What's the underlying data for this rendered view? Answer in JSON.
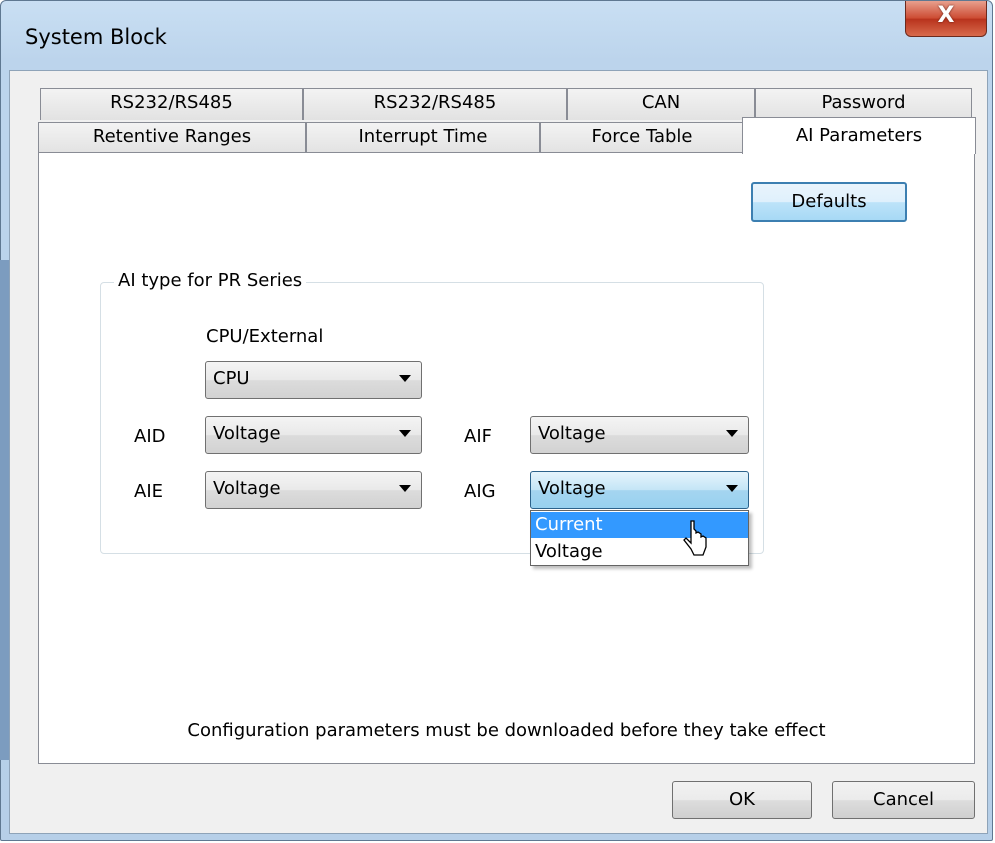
{
  "window": {
    "title": "System Block",
    "close_label": "X"
  },
  "tabs": {
    "row1": [
      "RS232/RS485",
      "RS232/RS485",
      "CAN",
      "Password"
    ],
    "row2": [
      "Retentive Ranges",
      "Interrupt Time",
      "Force Table",
      "AI Parameters"
    ],
    "active": "AI Parameters"
  },
  "panel": {
    "defaults_button": "Defaults",
    "group_title": "AI type for PR Series",
    "cpu_external_label": "CPU/External",
    "cpu_external_value": "CPU",
    "aid_label": "AID",
    "aid_value": "Voltage",
    "aie_label": "AIE",
    "aie_value": "Voltage",
    "aif_label": "AIF",
    "aif_value": "Voltage",
    "aig_label": "AIG",
    "aig_value": "Voltage",
    "aig_options": [
      "Current",
      "Voltage"
    ],
    "aig_highlighted": "Current",
    "note": "Configuration parameters must be downloaded before they take effect"
  },
  "footer": {
    "ok_label": "OK",
    "cancel_label": "Cancel"
  },
  "colors": {
    "titlebar": "#bcd4ec",
    "close_button": "#cc4a31",
    "selection": "#3399ff",
    "focus_border": "#3c7fb1"
  }
}
